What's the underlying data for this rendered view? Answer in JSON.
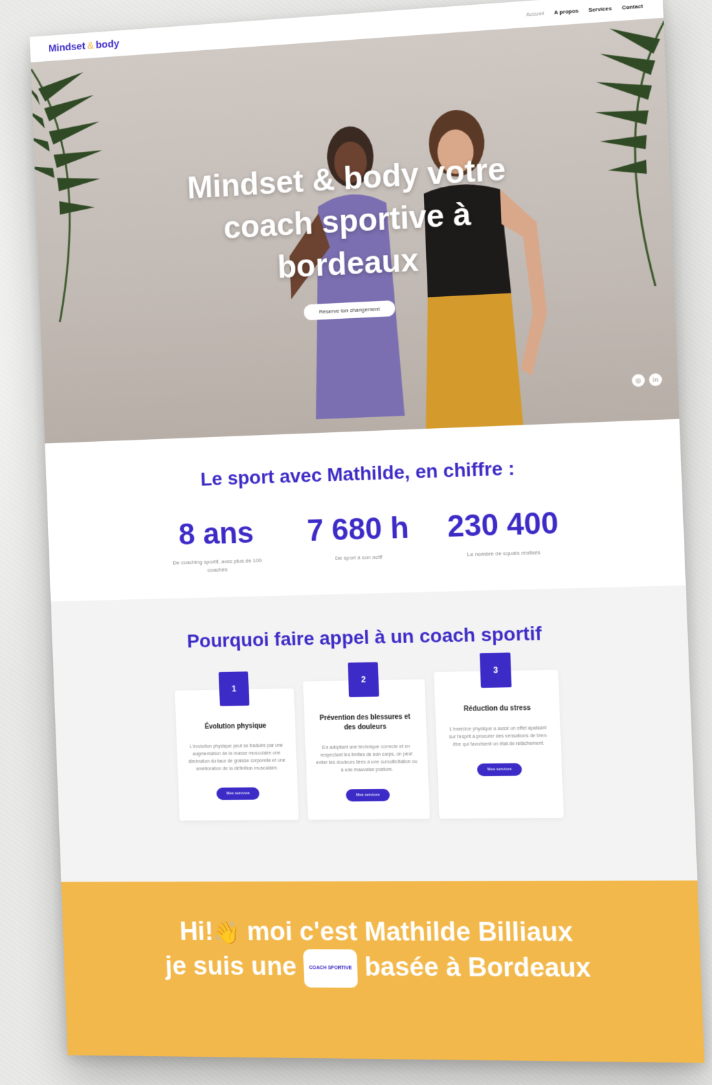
{
  "brand": {
    "name_part1": "Mindset",
    "amp": "&",
    "name_part2": "body",
    "primary_color": "#3d2bc7",
    "accent_color": "#f2b84b"
  },
  "nav": {
    "items": [
      {
        "label": "Accueil",
        "active": true
      },
      {
        "label": "A propos",
        "active": false
      },
      {
        "label": "Services",
        "active": false
      },
      {
        "label": "Contact",
        "active": false
      }
    ]
  },
  "hero": {
    "title": "Mindset & body votre coach sportive à bordeaux",
    "cta": "Réserve ton changement",
    "socials": [
      {
        "icon": "instagram-icon",
        "glyph": "◎"
      },
      {
        "icon": "linkedin-icon",
        "glyph": "in"
      }
    ]
  },
  "stats": {
    "title": "Le sport avec Mathilde, en chiffre :",
    "items": [
      {
        "value": "8 ans",
        "desc": "De coaching sportif, avec plus de 100 coachés"
      },
      {
        "value": "7 680 h",
        "desc": "De sport à son actif"
      },
      {
        "value": "230 400",
        "desc": "Le nombre de squats réalisés"
      }
    ]
  },
  "why": {
    "title": "Pourquoi faire appel à un coach sportif",
    "cards": [
      {
        "number": "1",
        "title": "Évolution physique",
        "body": "L'évolution physique peut se traduire par une augmentation de la masse musculaire une diminution du taux de graisse corporelle et une amélioration de la définition musculaire.",
        "button": "Mes services"
      },
      {
        "number": "2",
        "title": "Prévention des blessures et des douleurs",
        "body": "En adoptant une technique correcte et en respectant les limites de son corps, on peut éviter les douleurs liées à une sursollicitation ou à une mauvaise posture.",
        "button": "Mes services"
      },
      {
        "number": "3",
        "title": "Réduction du stress",
        "body": "L'exercice physique a aussi un effet apaisant sur l'esprit à procurer des sensations de bien-être qui favorisent un état de relâchement.",
        "button": "Mes services"
      }
    ]
  },
  "intro": {
    "line1_a": "Hi!",
    "line1_b": "moi c'est Mathilde Billiaux",
    "line2_a": "je suis une",
    "pill": "COACH SPORTIVE",
    "line2_b": "basée à Bordeaux"
  }
}
